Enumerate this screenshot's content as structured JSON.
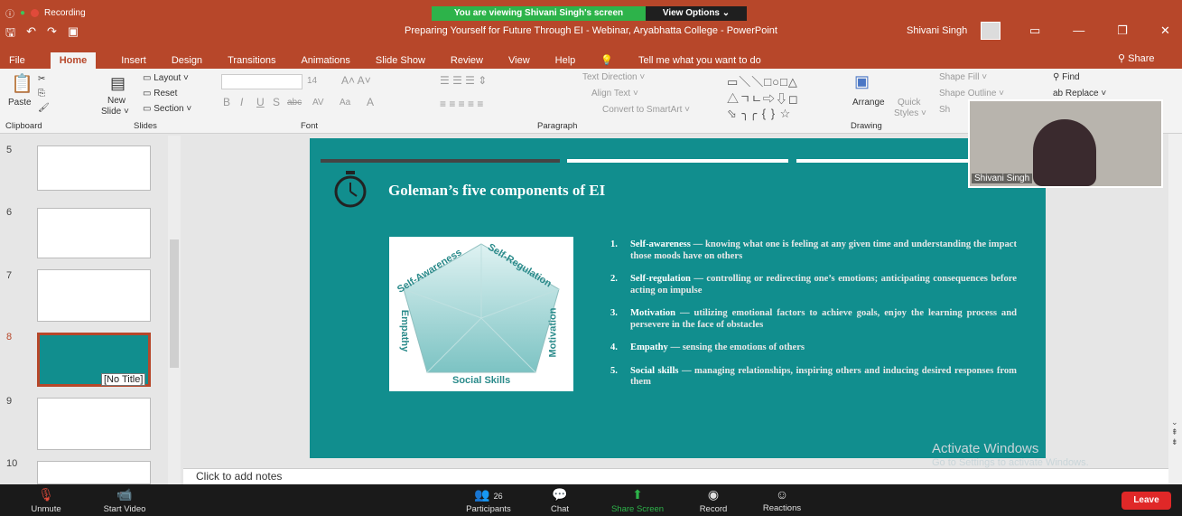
{
  "zoom": {
    "recording": "Recording",
    "viewing": "You are viewing Shivani Singh's screen",
    "view_options": "View Options ⌄",
    "toolbar": {
      "unmute": "Unmute",
      "start_video": "Start Video",
      "participants": "Participants",
      "participants_count": "26",
      "chat": "Chat",
      "share_screen": "Share Screen",
      "record": "Record",
      "reactions": "Reactions",
      "leave": "Leave"
    }
  },
  "window": {
    "title": "Preparing Yourself for Future Through EI - Webinar, Aryabhatta College  -  PowerPoint",
    "user": "Shivani Singh",
    "share": "Share"
  },
  "menu": {
    "tabs": [
      "File",
      "Home",
      "Insert",
      "Design",
      "Transitions",
      "Animations",
      "Slide Show",
      "Review",
      "View",
      "Help"
    ],
    "tell_me": "Tell me what you want to do"
  },
  "ribbon": {
    "clipboard": {
      "label": "Clipboard",
      "paste": "Paste"
    },
    "slides": {
      "label": "Slides",
      "new_slide": "New",
      "new_slide2": "Slide ˅",
      "layout": "Layout ˅",
      "reset": "Reset",
      "section": "Section ˅"
    },
    "font": {
      "label": "Font",
      "size": "14",
      "bold": "B",
      "italic": "I",
      "underline": "U",
      "shadow": "S",
      "strike": "abc",
      "spacing": "AV",
      "case": "Aa",
      "color": "A"
    },
    "paragraph": {
      "label": "Paragraph",
      "text_direction": "Text Direction ˅",
      "align_text": "Align Text ˅",
      "smartart": "Convert to SmartArt ˅"
    },
    "drawing": {
      "label": "Drawing",
      "arrange": "Arrange",
      "quick_styles": "Quick",
      "quick_styles2": "Styles ˅",
      "shape_fill": "Shape Fill ˅",
      "shape_outline": "Shape Outline ˅",
      "shape_effects": "Sh"
    },
    "editing": {
      "find": "Find",
      "replace": "Replace ˅"
    }
  },
  "slides_panel": {
    "numbers": [
      "5",
      "6",
      "7",
      "8",
      "9",
      "10"
    ],
    "tooltip": "[No Title]"
  },
  "slide": {
    "title": "Goleman’s five components of EI",
    "pentagon": {
      "labels": [
        "Self-Awareness",
        "Self-Regulation",
        "Motivation",
        "Social Skills",
        "Empathy"
      ]
    },
    "items": [
      {
        "n": "1.",
        "key": "Self-awareness",
        "desc": " — knowing what one is feeling at any given time and understanding the impact those moods have on others"
      },
      {
        "n": "2.",
        "key": "Self-regulation",
        "desc": " — controlling or redirecting one’s emotions; anticipating consequences before acting on impulse"
      },
      {
        "n": "3.",
        "key": "Motivation",
        "desc": " — utilizing emotional factors to achieve goals, enjoy the learning process and persevere in the face of obstacles"
      },
      {
        "n": "4.",
        "key": "Empathy",
        "desc": " — sensing the emotions of others"
      },
      {
        "n": "5.",
        "key": "Social skills",
        "desc": " — managing relationships, inspiring others and inducing desired responses from them"
      }
    ]
  },
  "notes": "Click to add notes",
  "video": {
    "name": "Shivani Singh"
  },
  "watermark": {
    "line1": "Activate Windows",
    "line2": "Go to Settings to activate Windows."
  },
  "colors": {
    "ppt_red": "#b7472a",
    "slide_teal": "#118e8e",
    "zoom_green": "#2db34a",
    "leave_red": "#e02828"
  }
}
